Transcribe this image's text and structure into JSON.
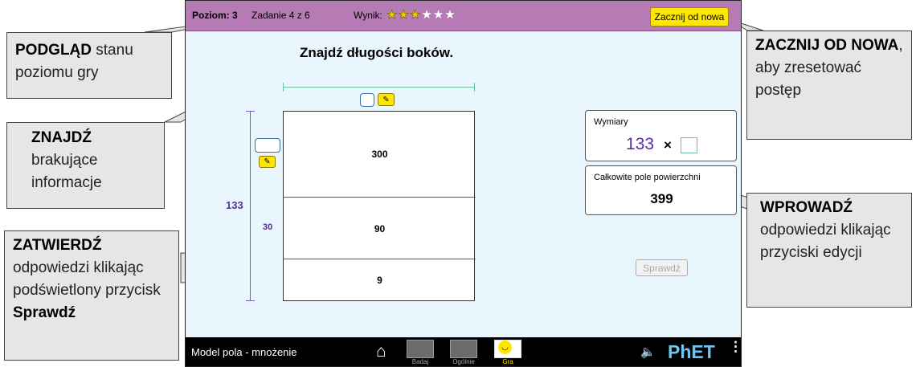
{
  "header": {
    "level": "Poziom: 3",
    "task": "Zadanie 4 z 6",
    "score_label": "Wynik:",
    "stars_filled": 3,
    "stars_total": 6,
    "restart_button": "Zacznij od nowa"
  },
  "main": {
    "heading": "Znajdź długości boków.",
    "left_dimension": "133",
    "row_dimension": "30",
    "cells": [
      "300",
      "90",
      "9"
    ],
    "dimensions_panel_title": "Wymiary",
    "dimension_value": "133",
    "times_sign": "×",
    "area_panel_title": "Całkowite pole powierzchni",
    "area_value": "399",
    "check_button": "Sprawdź"
  },
  "footer": {
    "sim_title": "Model pola - mnożenie",
    "nav": [
      "Badaj",
      "Ogólnie",
      "Gra"
    ],
    "brand": "PhET"
  },
  "callouts": {
    "preview_bold": "PODGLĄD",
    "preview_rest": "stanu poziomu gry",
    "restart_bold": "ZACZNIJ OD NOWA",
    "restart_rest": ", aby zresetować postęp",
    "find_bold": "ZNAJDŹ",
    "find_rest": "brakujące informacje",
    "submit_bold": "ZATWIERDŹ",
    "submit_rest": "odpowiedzi klikając podświetlony przycisk",
    "submit_tail": "Sprawdź",
    "enter_bold": "WPROWADŹ",
    "enter_rest": "odpowiedzi klikając przyciski edycji"
  },
  "colors": {
    "topbar": "#b67ab4",
    "dimension_purple": "#5b2ca8",
    "highlight_yellow": "#ffe600"
  }
}
